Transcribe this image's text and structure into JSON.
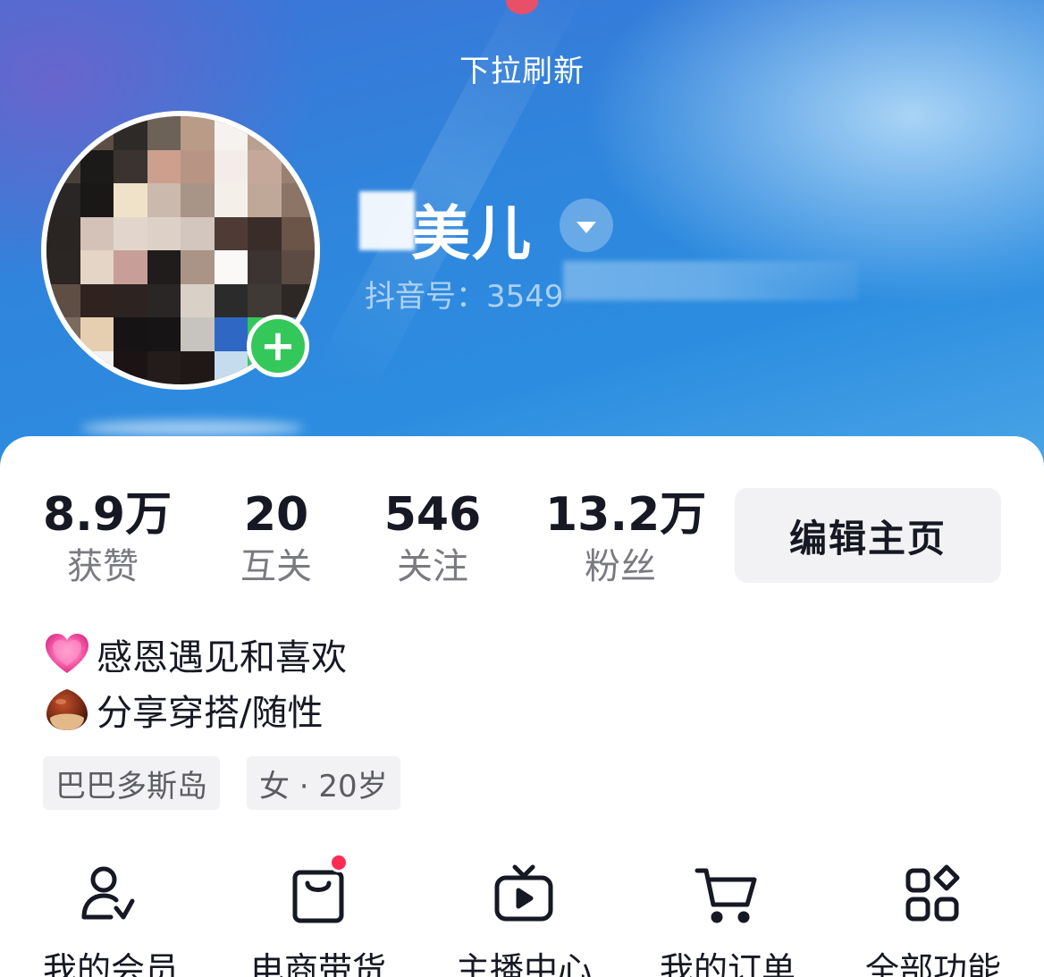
{
  "header": {
    "refresh_hint": "下拉刷新",
    "nickname": "美儿",
    "douyin_id": "抖音号：3549"
  },
  "stats": [
    {
      "value": "8.9万",
      "label": "获赞"
    },
    {
      "value": "20",
      "label": "互关"
    },
    {
      "value": "546",
      "label": "关注"
    },
    {
      "value": "13.2万",
      "label": "粉丝"
    }
  ],
  "edit_button": "编辑主页",
  "bio": [
    {
      "icon": "pink-heart-icon",
      "text": "感恩遇见和喜欢"
    },
    {
      "icon": "chestnut-icon",
      "text": "分享穿搭/随性"
    }
  ],
  "tags": [
    "巴巴多斯岛",
    "女 · 20岁"
  ],
  "functions": [
    {
      "icon": "member-icon",
      "label": "我的会员"
    },
    {
      "icon": "shopping-bag-icon",
      "label": "电商带货",
      "has_dot": true
    },
    {
      "icon": "live-tv-icon",
      "label": "主播中心"
    },
    {
      "icon": "cart-icon",
      "label": "我的订单"
    },
    {
      "icon": "all-functions-icon",
      "label": "全部功能"
    }
  ],
  "colors": {
    "header_blue": "#2f85dc",
    "accent_green": "#34c759",
    "notice_red": "#fe2c55"
  }
}
